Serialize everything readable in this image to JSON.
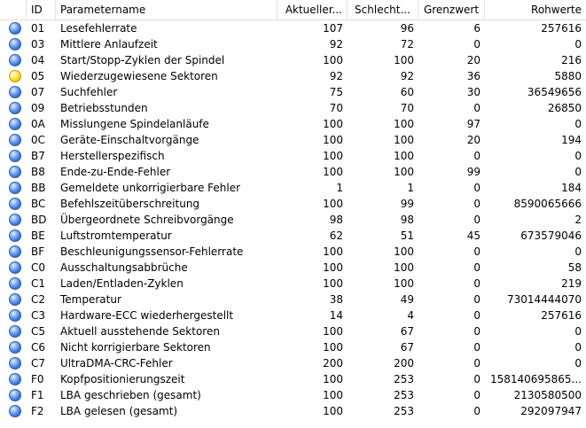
{
  "columns": {
    "id": "ID",
    "name": "Parametername",
    "current": "Aktueller...",
    "worst": "Schlecht...",
    "threshold": "Grenzwert",
    "raw": "Rohwerte"
  },
  "colors": {
    "good": "#3f76e0",
    "warn": "#f3cf10"
  },
  "rows": [
    {
      "status": "good",
      "id": "01",
      "name": "Lesefehlerrate",
      "current": "107",
      "worst": "96",
      "threshold": "6",
      "raw": "257616"
    },
    {
      "status": "good",
      "id": "03",
      "name": "Mittlere Anlaufzeit",
      "current": "92",
      "worst": "72",
      "threshold": "0",
      "raw": "0"
    },
    {
      "status": "good",
      "id": "04",
      "name": "Start/Stopp-Zyklen der Spindel",
      "current": "100",
      "worst": "100",
      "threshold": "20",
      "raw": "216"
    },
    {
      "status": "warn",
      "id": "05",
      "name": "Wiederzugewiesene Sektoren",
      "current": "92",
      "worst": "92",
      "threshold": "36",
      "raw": "5880"
    },
    {
      "status": "good",
      "id": "07",
      "name": "Suchfehler",
      "current": "75",
      "worst": "60",
      "threshold": "30",
      "raw": "36549656"
    },
    {
      "status": "good",
      "id": "09",
      "name": "Betriebsstunden",
      "current": "70",
      "worst": "70",
      "threshold": "0",
      "raw": "26850"
    },
    {
      "status": "good",
      "id": "0A",
      "name": "Misslungene Spindelanläufe",
      "current": "100",
      "worst": "100",
      "threshold": "97",
      "raw": "0"
    },
    {
      "status": "good",
      "id": "0C",
      "name": "Geräte-Einschaltvorgänge",
      "current": "100",
      "worst": "100",
      "threshold": "20",
      "raw": "194"
    },
    {
      "status": "good",
      "id": "B7",
      "name": "Herstellerspezifisch",
      "current": "100",
      "worst": "100",
      "threshold": "0",
      "raw": "0"
    },
    {
      "status": "good",
      "id": "B8",
      "name": "Ende-zu-Ende-Fehler",
      "current": "100",
      "worst": "100",
      "threshold": "99",
      "raw": "0"
    },
    {
      "status": "good",
      "id": "BB",
      "name": "Gemeldete unkorrigierbare Fehler",
      "current": "1",
      "worst": "1",
      "threshold": "0",
      "raw": "184"
    },
    {
      "status": "good",
      "id": "BC",
      "name": "Befehlszeitüberschreitung",
      "current": "100",
      "worst": "99",
      "threshold": "0",
      "raw": "8590065666"
    },
    {
      "status": "good",
      "id": "BD",
      "name": "Übergeordnete Schreibvorgänge",
      "current": "98",
      "worst": "98",
      "threshold": "0",
      "raw": "2"
    },
    {
      "status": "good",
      "id": "BE",
      "name": "Luftstromtemperatur",
      "current": "62",
      "worst": "51",
      "threshold": "45",
      "raw": "673579046"
    },
    {
      "status": "good",
      "id": "BF",
      "name": "Beschleunigungssensor-Fehlerrate",
      "current": "100",
      "worst": "100",
      "threshold": "0",
      "raw": "0"
    },
    {
      "status": "good",
      "id": "C0",
      "name": "Ausschaltungsabbrüche",
      "current": "100",
      "worst": "100",
      "threshold": "0",
      "raw": "58"
    },
    {
      "status": "good",
      "id": "C1",
      "name": "Laden/Entladen-Zyklen",
      "current": "100",
      "worst": "100",
      "threshold": "0",
      "raw": "219"
    },
    {
      "status": "good",
      "id": "C2",
      "name": "Temperatur",
      "current": "38",
      "worst": "49",
      "threshold": "0",
      "raw": "73014444070"
    },
    {
      "status": "good",
      "id": "C3",
      "name": "Hardware-ECC wiederhergestellt",
      "current": "14",
      "worst": "4",
      "threshold": "0",
      "raw": "257616"
    },
    {
      "status": "good",
      "id": "C5",
      "name": "Aktuell ausstehende Sektoren",
      "current": "100",
      "worst": "67",
      "threshold": "0",
      "raw": "0"
    },
    {
      "status": "good",
      "id": "C6",
      "name": "Nicht korrigierbare Sektoren",
      "current": "100",
      "worst": "67",
      "threshold": "0",
      "raw": "0"
    },
    {
      "status": "good",
      "id": "C7",
      "name": "UltraDMA-CRC-Fehler",
      "current": "200",
      "worst": "200",
      "threshold": "0",
      "raw": "0"
    },
    {
      "status": "good",
      "id": "F0",
      "name": "Kopfpositionierungszeit",
      "current": "100",
      "worst": "253",
      "threshold": "0",
      "raw": "158140695865..."
    },
    {
      "status": "good",
      "id": "F1",
      "name": "LBA geschrieben (gesamt)",
      "current": "100",
      "worst": "253",
      "threshold": "0",
      "raw": "2130580500"
    },
    {
      "status": "good",
      "id": "F2",
      "name": "LBA gelesen (gesamt)",
      "current": "100",
      "worst": "253",
      "threshold": "0",
      "raw": "292097947"
    }
  ]
}
